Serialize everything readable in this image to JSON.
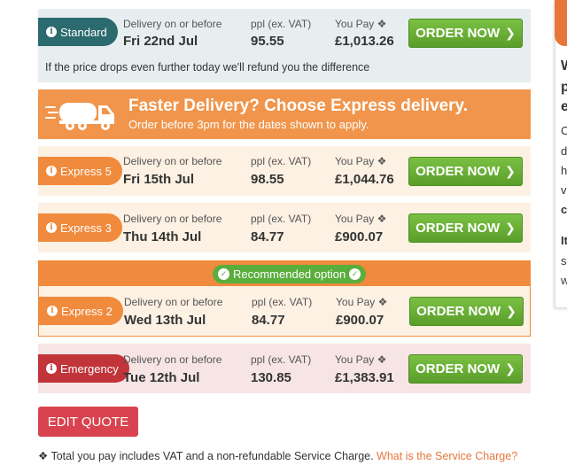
{
  "labels": {
    "delivery": "Delivery on or before",
    "ppl": "ppl (ex. VAT)",
    "you_pay": "You Pay ❖",
    "order_now": "ORDER NOW"
  },
  "standard": {
    "tag": "Standard",
    "date": "Fri 22nd Jul",
    "ppl": "95.55",
    "price": "£1,013.26",
    "refund_note": "If the price drops even further today we'll refund you the difference"
  },
  "express_banner": {
    "title": "Faster Delivery? Choose Express delivery.",
    "subtitle": "Order before 3pm for the dates shown to apply."
  },
  "express5": {
    "tag": "Express 5",
    "date": "Fri 15th Jul",
    "ppl": "98.55",
    "price": "£1,044.76"
  },
  "express3": {
    "tag": "Express 3",
    "date": "Thu 14th Jul",
    "ppl": "84.77",
    "price": "£900.07"
  },
  "recommended": {
    "label": "Recommended option"
  },
  "express2": {
    "tag": "Express 2",
    "date": "Wed 13th Jul",
    "ppl": "84.77",
    "price": "£900.07"
  },
  "emergency": {
    "tag": "Emergency",
    "date": "Tue 12th Jul",
    "ppl": "130.85",
    "price": "£1,383.91"
  },
  "edit_quote": "EDIT QUOTE",
  "footnote": {
    "text": "❖ Total you pay includes VAT and a non-refundable Service Charge. ",
    "link": "What is the Service Charge?"
  },
  "colors": {
    "standard_bg": "#e7eef0",
    "standard_tag": "#2b6a6e",
    "express_orange": "#f0954b",
    "express_row_bg": "#fdf1e3",
    "recommended_header": "#f08a3c",
    "recommended_badge": "#5aae3c",
    "emergency_bg": "#f7e5e5",
    "emergency_tag": "#c0343a",
    "order_green": "#6cb536",
    "edit_red": "#d9434f",
    "link_orange": "#e8763a"
  }
}
